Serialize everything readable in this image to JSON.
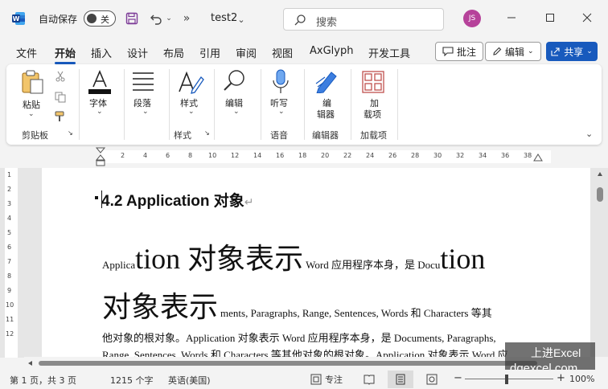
{
  "titlebar": {
    "autosave_label": "自动保存",
    "autosave_state": "关",
    "doc_title": "test2",
    "search_placeholder": "搜索",
    "avatar_initials": "JS",
    "more_commands": "»"
  },
  "tabs": [
    "文件",
    "开始",
    "插入",
    "设计",
    "布局",
    "引用",
    "审阅",
    "视图",
    "AxGlyph",
    "开发工具"
  ],
  "active_tab": "开始",
  "actions": {
    "comment_label": "批注",
    "edit_label": "编辑",
    "share_label": "共享"
  },
  "ribbon": {
    "paste_label": "粘贴",
    "clipboard_group": "剪贴板",
    "font_label": "字体",
    "paragraph_label": "段落",
    "styles_label": "样式",
    "styles_group": "样式",
    "editing_label": "编辑",
    "dictate_label": "听写",
    "voice_group": "语音",
    "editor_label_1": "编",
    "editor_label_2": "辑器",
    "editor_group": "编辑器",
    "addins_label_1": "加",
    "addins_label_2": "载项",
    "addins_group": "加载项"
  },
  "ruler": {
    "numbers": [
      "2",
      "4",
      "6",
      "8",
      "10",
      "12",
      "14",
      "16",
      "18",
      "20",
      "22",
      "24",
      "26",
      "28",
      "30",
      "32",
      "34",
      "36",
      "38"
    ],
    "vertical_numbers": [
      "1",
      "2",
      "3",
      "4",
      "5",
      "6",
      "7",
      "8",
      "9",
      "10",
      "11",
      "12"
    ]
  },
  "document": {
    "heading": "4.2 Application  对象",
    "line1_a": "Applica",
    "line1_b": "tion 对象表示",
    "line1_c": "Word 应用程序本身，是 Docu",
    "line1_d": "tion",
    "line2_a": "对象表示",
    "line2_b": "ments, Paragraphs, Range, Sentences, Words 和 Characters 等其",
    "line3": "他对象的根对象。Application 对象表示 Word 应用程序本身，是 Documents, Paragraphs,",
    "line4": "Range, Sentences, Words 和 Characters 等其他对象的根对象。Application 对象表示 Word 应"
  },
  "watermark": {
    "line1": "上进Excel",
    "line2": "dqexcel.com"
  },
  "statusbar": {
    "page_info": "第 1 页，共 3 页",
    "word_count": "1215 个字",
    "language": "英语(美国)",
    "focus_label": "专注",
    "zoom_level": "100%"
  },
  "colors": {
    "accent": "#185abd",
    "avatar": "#b6429a"
  }
}
